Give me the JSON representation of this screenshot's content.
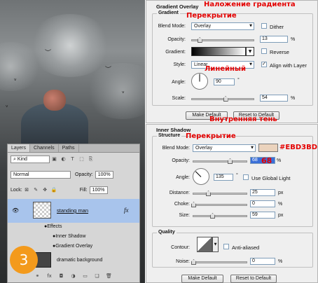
{
  "annotations": {
    "gradient_overlay_ru": "Наложение градиента",
    "overlay1_ru": "Перекрытие",
    "linear_ru": "Линейный",
    "inner_shadow_ru": "Внутренняя тень",
    "overlay2_ru": "Перекрытие",
    "color_hex": "#EBD3BD",
    "opacity_value": "68",
    "step_number": "3"
  },
  "colors": {
    "accent": "#e40000",
    "swatch": "#EBD3BD",
    "badge": "#f39a1c",
    "selection": "#a8c4ec"
  },
  "gradient_overlay": {
    "title": "Gradient Overlay",
    "group": "Gradient",
    "blend_mode_label": "Blend Mode:",
    "blend_mode": "Overlay",
    "dither_label": "Dither",
    "opacity_label": "Opacity:",
    "opacity": "13",
    "opacity_level": 13,
    "pct": "%",
    "gradient_label": "Gradient:",
    "reverse_label": "Reverse",
    "style_label": "Style:",
    "style": "Linear",
    "align_label": "Align with Layer",
    "angle_label": "Angle:",
    "angle": "90",
    "deg": "°",
    "scale_label": "Scale:",
    "scale": "54",
    "scale_level": 54,
    "make_default": "Make Default",
    "reset_default": "Reset to Default"
  },
  "inner_shadow": {
    "title": "Inner Shadow",
    "group": "Structure",
    "blend_mode_label": "Blend Mode:",
    "blend_mode": "Overlay",
    "opacity_label": "Opacity:",
    "opacity": "68",
    "opacity_level": 68,
    "pct": "%",
    "angle_label": "Angle:",
    "angle": "135",
    "deg": "°",
    "global_light_label": "Use Global Light",
    "distance_label": "Distance:",
    "distance": "25",
    "distance_unit": "px",
    "choke_label": "Choke:",
    "choke": "0",
    "choke_unit": "%",
    "size_label": "Size:",
    "size": "59",
    "size_unit": "px",
    "quality_title": "Quality",
    "contour_label": "Contour:",
    "anti_aliased_label": "Anti-aliased",
    "noise_label": "Noise:",
    "noise": "0",
    "noise_unit": "%",
    "make_default": "Make Default",
    "reset_default": "Reset to Default"
  },
  "layers_panel": {
    "tabs": [
      "Layers",
      "Channels",
      "Paths"
    ],
    "kind": "Kind",
    "blend": "Normal",
    "opacity_label": "Opacity:",
    "opacity": "100%",
    "lock_label": "Lock:",
    "fill_label": "Fill:",
    "fill": "100%",
    "layer1": "standing man",
    "fx": "fx",
    "effects": "Effects",
    "effect1": "Inner Shadow",
    "effect2": "Gradient Overlay",
    "layer2": "dramatic background"
  }
}
